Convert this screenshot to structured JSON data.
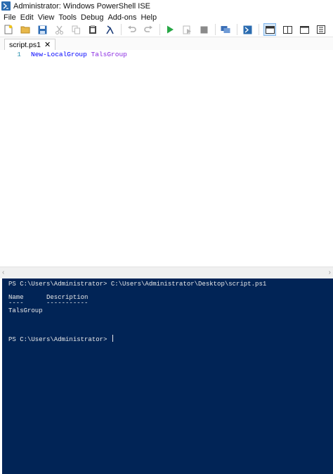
{
  "window": {
    "title": "Administrator: Windows PowerShell ISE"
  },
  "menu": [
    "File",
    "Edit",
    "View",
    "Tools",
    "Debug",
    "Add-ons",
    "Help"
  ],
  "toolbar": {
    "icons": [
      "new-icon",
      "open-icon",
      "save-icon",
      "cut-icon",
      "copy-icon",
      "paste-icon",
      "clear-icon",
      "undo-icon",
      "redo-icon",
      "run-icon",
      "run-selection-icon",
      "stop-icon",
      "new-remote-tab-icon",
      "start-powershell-icon",
      "show-script-top-icon",
      "show-script-right-icon",
      "show-script-max-icon",
      "show-commands-icon"
    ]
  },
  "tab": {
    "label": "script.ps1",
    "close": "✕"
  },
  "editor": {
    "lines": [
      {
        "number": "1",
        "keyword": "New-LocalGroup",
        "argument": "TalsGroup"
      }
    ]
  },
  "console": {
    "command_line": "PS C:\\Users\\Administrator> C:\\Users\\Administrator\\Desktop\\script.ps1",
    "header": "Name      Description",
    "underline": "----      -----------",
    "result": "TalsGroup",
    "prompt": "PS C:\\Users\\Administrator> "
  },
  "colors": {
    "console_bg": "#012456",
    "keyword": "#0000ff",
    "argument": "#8a2be2",
    "line_number": "#2b91af"
  }
}
